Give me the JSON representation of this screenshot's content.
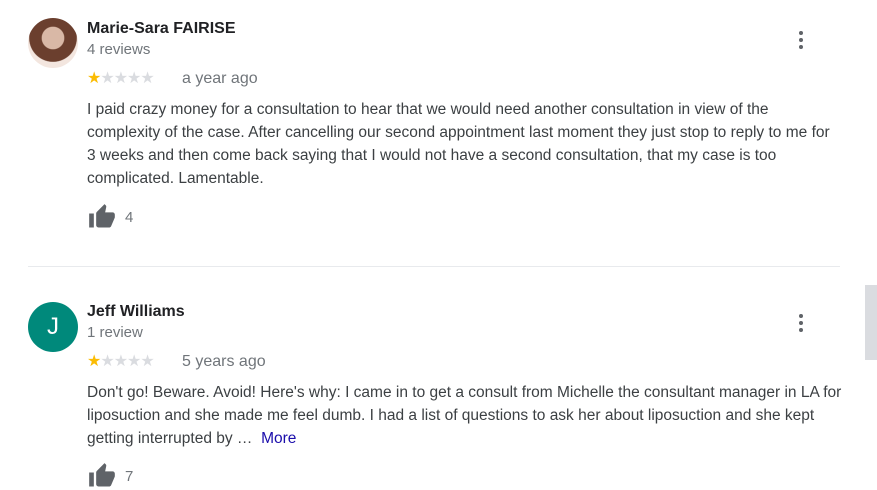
{
  "reviews": [
    {
      "name": "Marie-Sara FAIRISE",
      "count": "4 reviews",
      "stars_filled": "★",
      "stars_empty": "★★★★",
      "rating": 1,
      "date": "a year ago",
      "text": "I paid crazy money for a consultation to hear that we would need another consultation in view of the complexity of the case. After cancelling our second appointment last moment they just stop to reply to me for 3 weeks and then come back saying that I would not have a second consultation, that my case is too complicated. Lamentable.",
      "likes": "4",
      "avatar_icon": "user-photo"
    },
    {
      "name": "Jeff Williams",
      "count": "1 review",
      "stars_filled": "★",
      "stars_empty": "★★★★",
      "rating": 1,
      "date": "5 years ago",
      "text": "Don't go! Beware. Avoid! Here's why: I came in to get a consult from Michelle the consultant manager in LA for liposuction and she made me feel dumb. I had a list of questions to ask her about liposuction and she kept getting interrupted by …",
      "more": "More",
      "likes": "7",
      "avatar_letter": "J"
    }
  ],
  "colors": {
    "star": "#fbbc04",
    "avatar_bg": "#00897b",
    "link": "#1a0dab"
  }
}
